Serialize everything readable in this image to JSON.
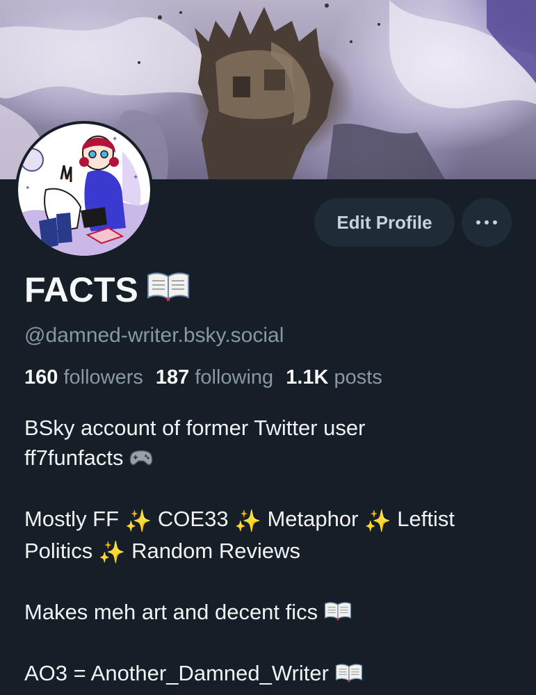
{
  "profile": {
    "display_name": "FACTS",
    "name_emoji": "open-book-icon",
    "handle": "@damned-writer.bsky.social"
  },
  "actions": {
    "edit_label": "Edit Profile",
    "more_icon": "ellipsis-icon"
  },
  "stats": {
    "followers_count": "160",
    "followers_label": "followers",
    "following_count": "187",
    "following_label": "following",
    "posts_count": "1.1K",
    "posts_label": "posts"
  },
  "bio": {
    "line1": "BSky account of former Twitter user",
    "line2": "ff7funfacts",
    "line3_parts": [
      "Mostly FF",
      "COE33",
      "Metaphor",
      "Leftist"
    ],
    "line4_parts": [
      "Politics",
      "Random Reviews"
    ],
    "line5": "Makes meh art and decent fics",
    "line6": "AO3 = Another_Damned_Writer"
  },
  "colors": {
    "background": "#161e27",
    "button_bg": "#1f2b37",
    "secondary_text": "#8a97a5"
  }
}
